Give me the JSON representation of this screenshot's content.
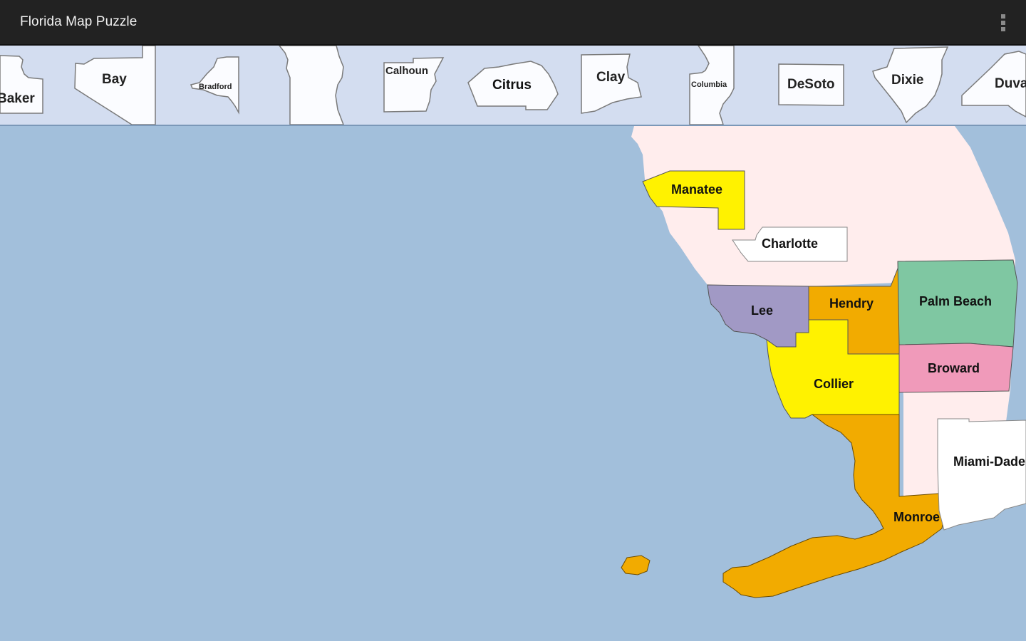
{
  "app": {
    "title": "Florida Map Puzzle",
    "menu_icon": "overflow-menu-icon"
  },
  "tray": {
    "pieces": [
      {
        "name": "Baker"
      },
      {
        "name": "Bay"
      },
      {
        "name": "Bradford"
      },
      {
        "name": ""
      },
      {
        "name": "Calhoun"
      },
      {
        "name": "Citrus"
      },
      {
        "name": "Clay"
      },
      {
        "name": "Columbia"
      },
      {
        "name": "DeSoto"
      },
      {
        "name": "Dixie"
      },
      {
        "name": "Duval"
      }
    ]
  },
  "map": {
    "colors": {
      "water": "#a2bfdb",
      "land_unplaced": "#ffeded",
      "yellow": "#fff200",
      "orange": "#f2ab00",
      "purple": "#a199c5",
      "green": "#7fc7a2",
      "pink": "#f09aba",
      "white_piece": "#ffffff"
    },
    "counties": [
      {
        "name": "Manatee",
        "color": "#fff200",
        "state": "placed"
      },
      {
        "name": "Charlotte",
        "color": "#ffffff",
        "state": "dragging"
      },
      {
        "name": "Lee",
        "color": "#a199c5",
        "state": "placed"
      },
      {
        "name": "Hendry",
        "color": "#f2ab00",
        "state": "placed"
      },
      {
        "name": "Palm Beach",
        "color": "#7fc7a2",
        "state": "placed"
      },
      {
        "name": "Broward",
        "color": "#f09aba",
        "state": "placed"
      },
      {
        "name": "Collier",
        "color": "#fff200",
        "state": "placed"
      },
      {
        "name": "Miami-Dade",
        "color": "#ffffff",
        "state": "dragging"
      },
      {
        "name": "Monroe",
        "color": "#f2ab00",
        "state": "placed"
      }
    ]
  }
}
